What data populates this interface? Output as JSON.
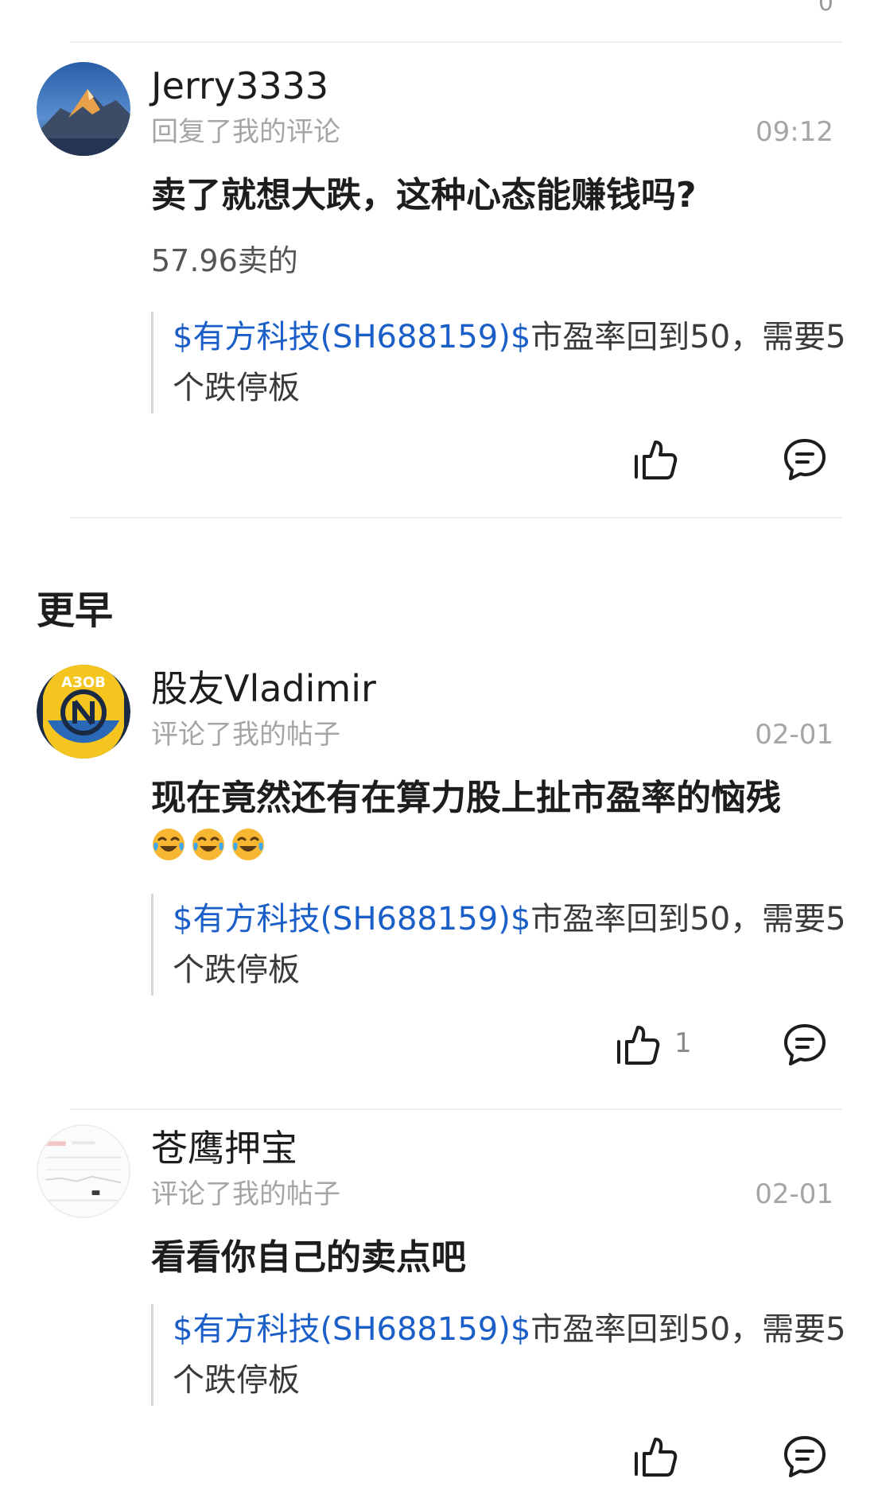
{
  "top_sliver": "0",
  "section_earlier": "更早",
  "comments": [
    {
      "user": "Jerry3333",
      "action": "回复了我的评论",
      "time": "09:12",
      "text": "卖了就想大跌，这种心态能赚钱吗?",
      "sub": "57.96卖的",
      "quote_stock": "$有方科技(SH688159)$",
      "quote_rest": "市盈率回到50，需要5个跌停板",
      "likes": ""
    },
    {
      "user": "股友Vladimir",
      "action": "评论了我的帖子",
      "time": "02-01",
      "text": "现在竟然还有在算力股上扯市盈率的恼残",
      "emojis": [
        "laughing-crying",
        "laughing-crying",
        "laughing-crying"
      ],
      "avatar_text": "АЗОВ",
      "quote_stock": "$有方科技(SH688159)$",
      "quote_rest": "市盈率回到50，需要5个跌停板",
      "likes": "1"
    },
    {
      "user": "苍鹰押宝",
      "action": "评论了我的帖子",
      "time": "02-01",
      "text": "看看你自己的卖点吧",
      "quote_stock": "$有方科技(SH688159)$",
      "quote_rest": "市盈率回到50，需要5个跌停板",
      "likes": ""
    }
  ],
  "colors": {
    "link": "#1a5ec8",
    "muted": "#a5a5a5",
    "text": "#1d1d1f"
  }
}
